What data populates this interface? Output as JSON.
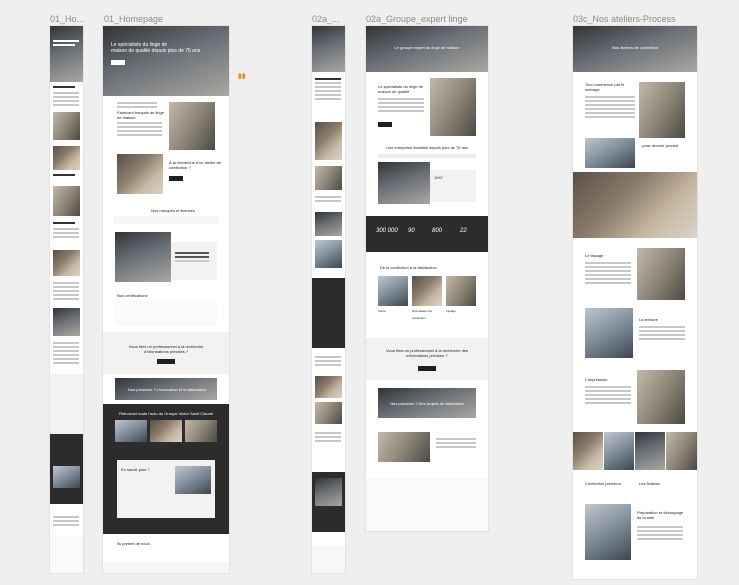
{
  "frames": {
    "f1": {
      "title": "01_Ho..."
    },
    "f2": {
      "title": "01_Homepage"
    },
    "f3": {
      "title": "02a_..."
    },
    "f4": {
      "title": "02a_Groupe_expert linge"
    },
    "f5": {
      "title": "03c_Nos ateliers-Process"
    }
  },
  "homepage": {
    "hero_line1": "Le spécialiste du linge de",
    "hero_line2": "maison de qualité depuis plus de 75 ans",
    "section_made": "Fabricant français de linge de maison",
    "section_workshop": "À la recherche d'un atelier de confection ?",
    "brands_title": "Nos marques et licences",
    "labels_title": "Nos certifications",
    "pro_line1": "Vous êtes un professionnel à la recherche",
    "pro_line2": "d'informations précises ?",
    "dark_banner": "Nos passions ? L'innovation et la fabrication",
    "dark_title": "Retrouvez toute l'actu du Groupe Victor Saint Claude",
    "contact": "En savoir plus ?",
    "partners": "Ils parlent de nous"
  },
  "groupe": {
    "hero": "Le groupe expert du linge de maison",
    "intro": "Le spécialiste du linge de maison de qualité",
    "history": "Une entreprise familiale depuis plus de 75 ans",
    "year_label": "1947",
    "stats": [
      "300 000",
      "90",
      "800",
      "22"
    ],
    "confection": "De la confection à la distribution",
    "cards": [
      "Vente",
      "Nos ateliers de confection",
      "Lavage"
    ],
    "pro_line1": "Vous êtes un professionnel à la recherche des",
    "pro_line2": "informations précises ?",
    "banner": "Nos passions ? Des projets de fabrication"
  },
  "process": {
    "hero": "Nos ateliers de confection",
    "intro_title": "Tout commence par le métrage",
    "chapter1": "...pour devenir produit",
    "step_tissage": "Le tissage",
    "step_teinture": "La teinture",
    "step_impression": "L'impression",
    "bottom_left": "Confection premium",
    "bottom_right": "Les finitions",
    "prep_title": "Préparation et découpage de la toile"
  }
}
